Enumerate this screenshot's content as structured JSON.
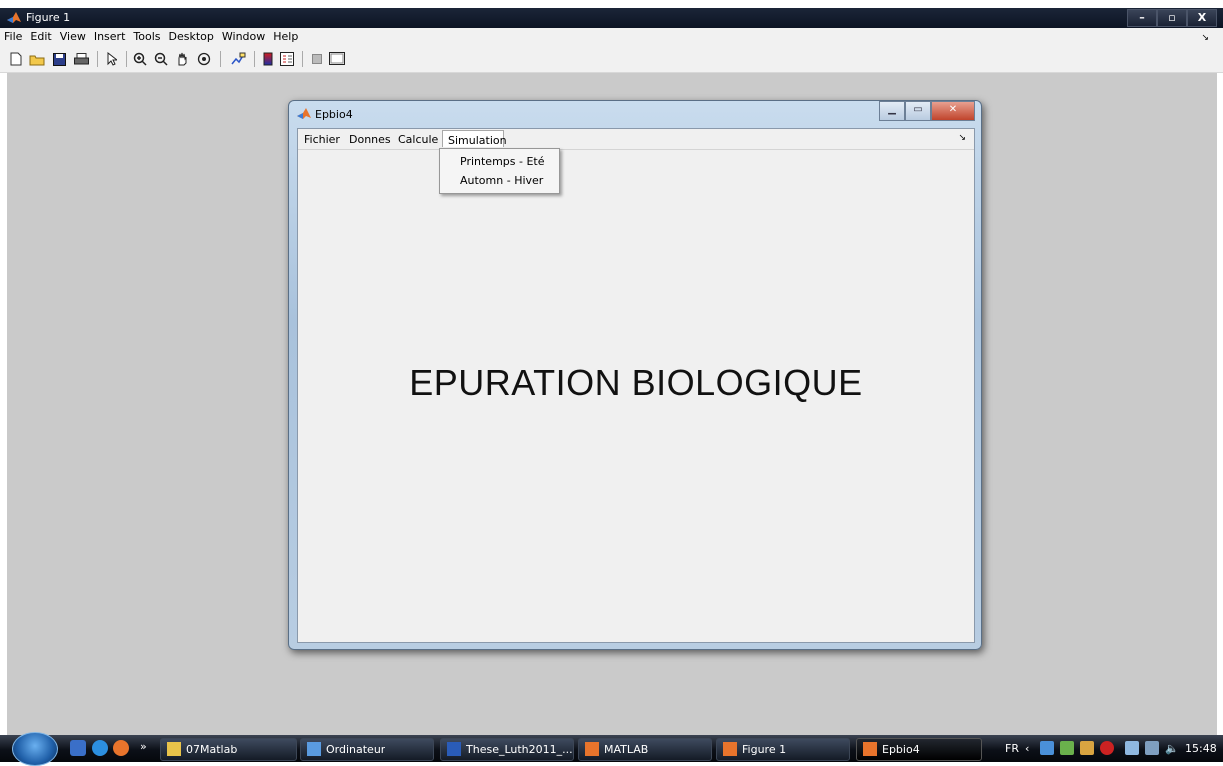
{
  "outer_window": {
    "title": "Figure 1",
    "controls": [
      "–",
      "▫",
      "X"
    ]
  },
  "outer_menu": {
    "items": [
      "File",
      "Edit",
      "View",
      "Insert",
      "Tools",
      "Desktop",
      "Window",
      "Help"
    ]
  },
  "toolbar": {
    "icons": [
      "new-file-icon",
      "open-folder-icon",
      "save-icon",
      "print-icon",
      "pointer-icon",
      "zoom-in-icon",
      "zoom-out-icon",
      "pan-hand-icon",
      "rotate-3d-icon",
      "data-cursor-icon",
      "colorbar-icon",
      "legend-icon",
      "hide-plot-tools-icon",
      "show-plot-tools-icon"
    ]
  },
  "inner_window": {
    "title": "Epbio4",
    "menu": [
      "Fichier",
      "Donnes",
      "Calcule",
      "Simulation"
    ],
    "active_menu": "Simulation",
    "dropdown": [
      "Printemps - Eté",
      "Automn - Hiver"
    ],
    "main_text": "EPURATION BIOLOGIQUE"
  },
  "taskbar": {
    "tasks": [
      "07Matlab",
      "Ordinateur",
      "These_Luth2011_...",
      "MATLAB",
      "Figure 1",
      "Epbio4"
    ],
    "language": "FR",
    "clock": "15:48"
  },
  "colors": {
    "figure_background": "#cacaca",
    "client_background": "#f0f0f0",
    "title_bar_dark": "#0c1424",
    "close_button": "#c0442c"
  }
}
